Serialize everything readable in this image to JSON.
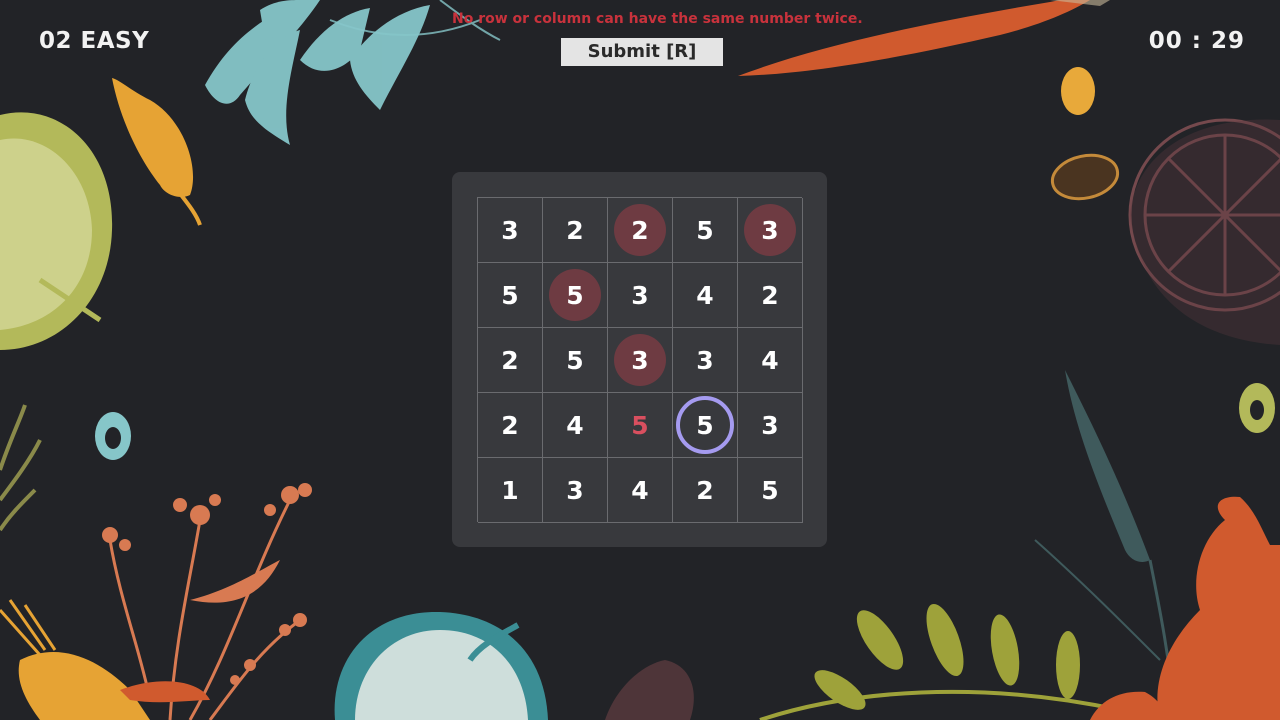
{
  "header": {
    "level_label": "02 EASY",
    "timer": "00 : 29",
    "hint": "No row or column can have the same number twice.",
    "submit_label": "Submit [R]"
  },
  "colors": {
    "background": "#222327",
    "board": "#38393d",
    "shaded_disc": "#6e3b42",
    "selection_ring": "#a59bf0",
    "error_text": "#d94f5f",
    "hint_text": "#c8323c"
  },
  "decorations": [
    "carrot-icon",
    "apple-icon",
    "herb-leaf-icon",
    "chili-pepper-icon",
    "lemon-slice-icon",
    "bean-icon",
    "wheat-icon",
    "ginger-icon",
    "flower-sprig-icon",
    "rosemary-icon"
  ],
  "board": {
    "size": 5,
    "cells": [
      [
        {
          "v": "3",
          "s": "plain"
        },
        {
          "v": "2",
          "s": "plain"
        },
        {
          "v": "2",
          "s": "shaded"
        },
        {
          "v": "5",
          "s": "plain"
        },
        {
          "v": "3",
          "s": "shaded"
        }
      ],
      [
        {
          "v": "5",
          "s": "plain"
        },
        {
          "v": "5",
          "s": "shaded"
        },
        {
          "v": "3",
          "s": "plain"
        },
        {
          "v": "4",
          "s": "plain"
        },
        {
          "v": "2",
          "s": "plain"
        }
      ],
      [
        {
          "v": "2",
          "s": "plain"
        },
        {
          "v": "5",
          "s": "plain"
        },
        {
          "v": "3",
          "s": "shaded"
        },
        {
          "v": "3",
          "s": "plain"
        },
        {
          "v": "4",
          "s": "plain"
        }
      ],
      [
        {
          "v": "2",
          "s": "plain"
        },
        {
          "v": "4",
          "s": "plain"
        },
        {
          "v": "5",
          "s": "error"
        },
        {
          "v": "5",
          "s": "circled"
        },
        {
          "v": "3",
          "s": "plain"
        }
      ],
      [
        {
          "v": "1",
          "s": "plain"
        },
        {
          "v": "3",
          "s": "plain"
        },
        {
          "v": "4",
          "s": "plain"
        },
        {
          "v": "2",
          "s": "plain"
        },
        {
          "v": "5",
          "s": "plain"
        }
      ]
    ]
  }
}
